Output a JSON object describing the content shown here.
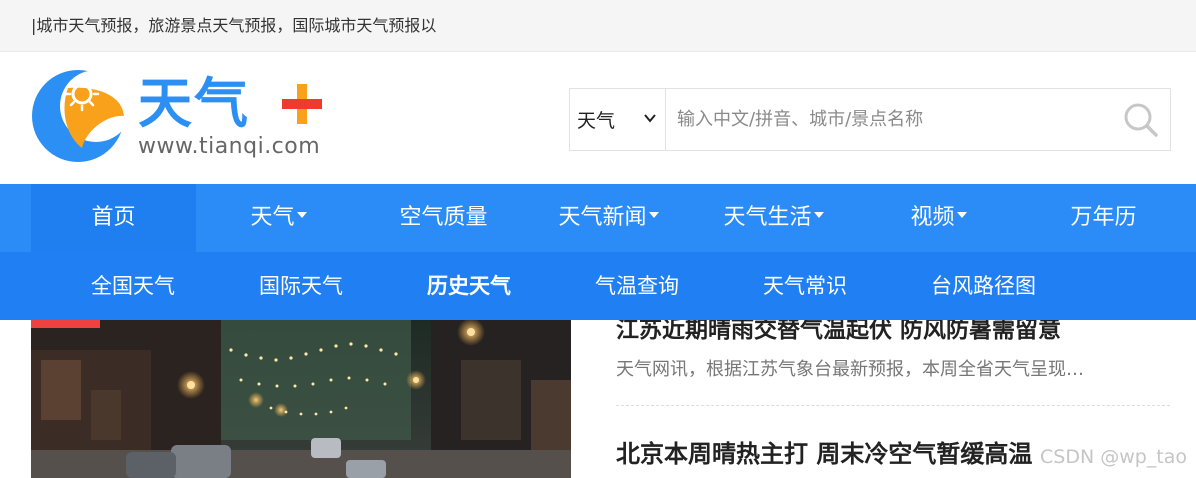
{
  "topbar": {
    "ticker": "|城市天气预报，旅游景点天气预报，国际城市天气预报以"
  },
  "logo": {
    "text": "天气",
    "url": "www.tianqi.com",
    "colors": {
      "blue": "#2c8ff3",
      "orange": "#f9a11b",
      "red": "#ef3b2d"
    }
  },
  "search": {
    "select_value": "天气",
    "placeholder": "输入中文/拼音、城市/景点名称",
    "icon": "search-icon"
  },
  "nav": {
    "items": [
      {
        "label": "首页",
        "dropdown": false,
        "active": true
      },
      {
        "label": "天气",
        "dropdown": true
      },
      {
        "label": "空气质量",
        "dropdown": false
      },
      {
        "label": "天气新闻",
        "dropdown": true
      },
      {
        "label": "天气生活",
        "dropdown": true
      },
      {
        "label": "视频",
        "dropdown": true
      },
      {
        "label": "万年历",
        "dropdown": false
      }
    ]
  },
  "subnav": {
    "items": [
      {
        "label": "全国天气"
      },
      {
        "label": "国际天气"
      },
      {
        "label": "历史天气",
        "active": true
      },
      {
        "label": "气温查询"
      },
      {
        "label": "天气常识"
      },
      {
        "label": "台风路径图"
      }
    ]
  },
  "news": {
    "headline1": "江苏近期晴雨交替气温起伏 防风防暑需留意",
    "summary1": "天气网讯，根据江苏气象台最新预报，本周全省天气呈现…",
    "headline2": "北京本周晴热主打 周末冷空气暂缓高温"
  },
  "watermark": "CSDN @wp_tao",
  "theme": {
    "nav_bg": "#2b8cf8",
    "subnav_bg": "#2080f3",
    "accent_red": "#f04141"
  }
}
